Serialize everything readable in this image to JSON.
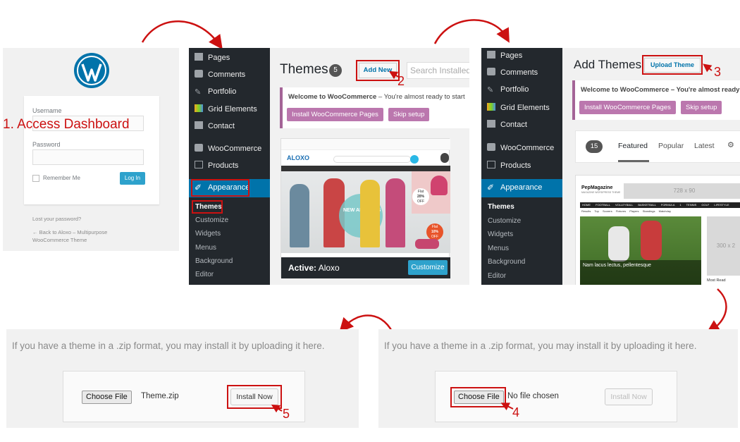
{
  "login": {
    "step_label": "1. Access Dashboard",
    "username_label": "Username",
    "password_label": "Password",
    "remember_label": "Remember Me",
    "login_button": "Log In",
    "lost_password": "Lost your password?",
    "back_link_line1": "← Back to Aloxo – Multipurpose",
    "back_link_line2": "WooCommerce Theme"
  },
  "sidebar": {
    "items": [
      "Pages",
      "Comments",
      "Portfolio",
      "Grid Elements",
      "Contact",
      "WooCommerce",
      "Products",
      "Appearance"
    ],
    "submenu": [
      "Themes",
      "Customize",
      "Widgets",
      "Menus",
      "Background",
      "Editor"
    ]
  },
  "themes_page": {
    "title": "Themes",
    "count": "5",
    "add_new": "Add New",
    "search_placeholder": "Search Installed",
    "step_number": "2",
    "notice_bold": "Welcome to WooCommerce",
    "notice_rest": " – You're almost ready to start",
    "install_pages_button": "Install WooCommerce Pages",
    "skip_button": "Skip setup",
    "active_prefix": "Active:",
    "active_theme": "Aloxo",
    "customize_button": "Customize",
    "preview_logo": "ALOXO",
    "preview_banner": "NEW ARRIVALS",
    "preview_badge1_line1": "Flat",
    "preview_badge1_line2": "20%",
    "preview_badge1_line3": "OFF",
    "preview_badge2_line1": "Flat",
    "preview_badge2_line2": "10%",
    "preview_badge2_line3": "OFF"
  },
  "add_themes_page": {
    "title": "Add Themes",
    "upload_button": "Upload Theme",
    "step_number": "3",
    "notice_text": "Welcome to WooCommerce – You're almost ready",
    "install_pages_button": "Install WooCommerce Pages",
    "skip_button": "Skip setup",
    "filter_count": "15",
    "tabs": [
      "Featured",
      "Popular",
      "Latest"
    ],
    "preview_logo": "PepMagazine",
    "preview_tagline": "MAGAZINE WORDPRESS THEME",
    "preview_ad": "728 x 90",
    "preview_ad2": "300 x 2",
    "preview_menu": [
      "HOME",
      "FOOTBALL",
      "VOLLEYBALL",
      "BASKETBALL",
      "FORMULA 1",
      "TENNIS",
      "GOLF",
      "LIFESTYLE"
    ],
    "preview_submenu": [
      "Results",
      "Top Scorers",
      "Fixtures",
      "Players",
      "Standings",
      "Matchday"
    ],
    "preview_caption": "Nam lacus lectus, pellentesque",
    "preview_most_read": "Most Read"
  },
  "upload_right": {
    "message": "If you have a theme in a .zip format, you may install it by uploading it here.",
    "choose_file": "Choose File",
    "file_status": "No file chosen",
    "install_button": "Install Now",
    "step_number": "4"
  },
  "upload_left": {
    "message": "If you have a theme in a .zip format, you may install it by uploading it here.",
    "choose_file": "Choose File",
    "file_status": "Theme.zip",
    "install_button": "Install Now",
    "step_number": "5"
  },
  "colors": {
    "wp_dark": "#23282d",
    "wp_blue": "#0073aa",
    "woo_purple": "#bb77ae",
    "annotation_red": "#cc1111"
  }
}
